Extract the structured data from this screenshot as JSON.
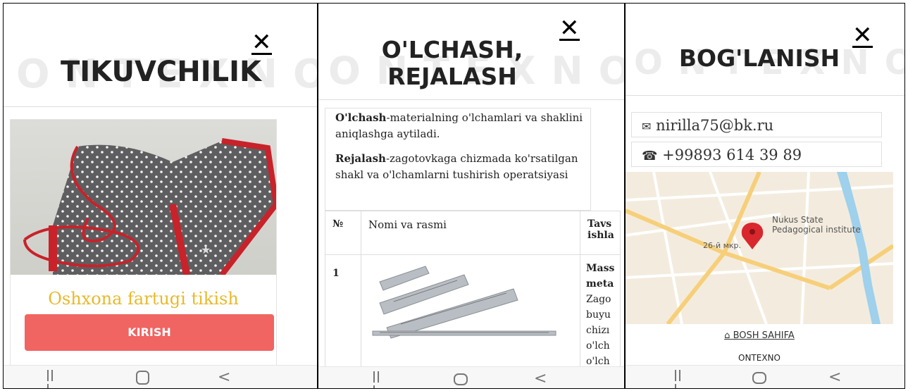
{
  "panel1": {
    "close_icon": "✕",
    "bg_word": "ONTEXNO",
    "title": "TIKUVCHILIK",
    "caption": "Oshxona fartugi tikish",
    "button_label": "KIRISH"
  },
  "panel2": {
    "close_icon": "✕",
    "bg_word": "ONTEXNO",
    "title_line1": "O'LCHASH,",
    "title_line2": "REJALASH",
    "p1_bold": "O'lchash",
    "p1_text": "-materialning o'lchamlari va shaklini aniqlashga aytiladi.",
    "p2_bold": "Rejalash",
    "p2_text": "-zagotovkaga chizmada ko'rsatilgan shakl va o'lchamlarni tushirish operatsiyasi",
    "table": {
      "headers": [
        "№",
        "Nomi va rasmi",
        "Tavs ishla"
      ],
      "row1_num": "1",
      "row1_desc_bold": "Mass meta",
      "row1_desc_lines": [
        "Zago",
        "buyu",
        "chizı",
        "o'lch",
        "o'lch"
      ]
    }
  },
  "panel3": {
    "close_icon": "✕",
    "bg_word": "ONTEXNO",
    "title": "BOG'LANISH",
    "email": "nirilla75@bk.ru",
    "phone": "+99893 614 39 89",
    "map_place_line1": "Nukus State",
    "map_place_line2": "Pedagogical institute",
    "map_district": "26-й мкр.",
    "home_link": "BOSH SAHIFA",
    "footer": "ONTEXNO"
  },
  "icons": {
    "email": "envelope-icon",
    "phone": "phone-icon",
    "home": "home-icon",
    "map_pin": "map-pin-icon"
  },
  "colors": {
    "button": "#f06462",
    "caption": "#e8b92b",
    "pin": "#d9272e"
  }
}
